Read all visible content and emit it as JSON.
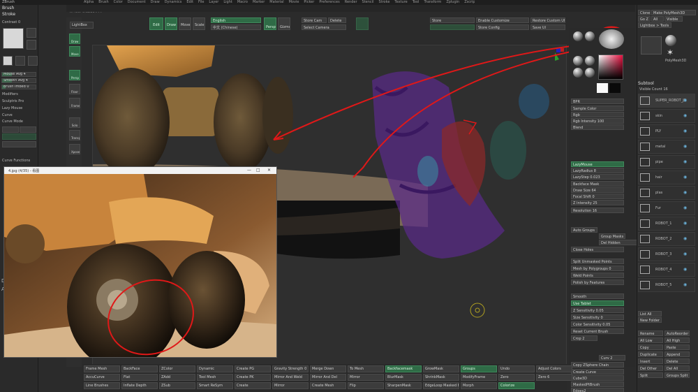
{
  "topbar": {
    "left_title": "ZBrush",
    "menus": [
      "Alpha",
      "Brush",
      "Color",
      "Document",
      "Draw",
      "Dynamics",
      "Edit",
      "File",
      "Layer",
      "Light",
      "Macro",
      "Marker",
      "Material",
      "Movie",
      "Picker",
      "Preferences",
      "Render",
      "Stencil",
      "Stroke",
      "Texture",
      "Tool",
      "Transform",
      "Zplugin",
      "Zscript",
      "Help"
    ],
    "coords": "X:466.-0.3213.777"
  },
  "left_panel": {
    "tabs": [
      "Brush",
      "Stroke"
    ],
    "header_value": "Contrast 0",
    "items": [
      "Mouse Avg 4",
      "Smooth Avg 4",
      "Brush Imbed 0",
      "Modifiers",
      "Sculptris Pro",
      "Lazy Mouse",
      "Curve",
      "Curve Mode",
      "Curve Functions"
    ],
    "brush_labels": [
      "Standard",
      "Move",
      "DragDot",
      "Spray"
    ],
    "brush_labels2": [
      "FreeHand",
      "Dots",
      "DragRect"
    ],
    "side_letters": [
      "D",
      "A"
    ]
  },
  "toolbar": {
    "lightbox": "LightBox",
    "edit": "Edit",
    "draw": "Draw",
    "move": "Move",
    "scale": "Scale",
    "rotate": "Rotate",
    "english": "English",
    "persp": "Persp",
    "gizmo": "Gizmo",
    "store_cam": "Store Cam",
    "delete": "Delete",
    "select_camera": "Select Camera",
    "store": "Store",
    "enable_customize": "Enable Customize",
    "restore_custom_ui": "Restore Custom UI",
    "store_config": "Store Config",
    "save_ui": "Save UI",
    "flag_cn": "中文 (Chinese)"
  },
  "left_icons": {
    "items": [
      "Draw",
      "Move",
      "Persp",
      "Floor",
      "Frame",
      "Solo",
      "Transp",
      "Xpose"
    ]
  },
  "image_window": {
    "title": "4.jpg (4/35) - 看图",
    "controls": [
      "—",
      "□",
      "✕"
    ]
  },
  "right_inner_panel": {
    "values": [
      "BPR",
      "Sample Color",
      "Rgb",
      "Rgb Intensity 100",
      "Blend",
      "LazyMouse",
      "LazyRadius 8",
      "LazyStep 0.023",
      "Backface Mask",
      "Draw Size 64",
      "Focal Shift 0",
      "Z Intensity 25",
      "Resolution 16",
      "Auto Groups",
      "Group Masks",
      "Del Hidden",
      "Close Holes",
      "Split Unmasked Points",
      "Mesh by Polygroups 0",
      "Weld Points",
      "Polish by Features",
      "Smooth",
      "Use Tablet",
      "Z Sensitivity 0.05",
      "Size Sensitivity 0",
      "Color Sensitivity 0.05",
      "Reset Current Brush",
      "Crop 2",
      "Curv 2",
      "Copy ZSphere Chain",
      "Create Curve",
      "Cube3D",
      "MaskedPtBrush",
      "Edges2",
      "Mrgb",
      "Zadd"
    ],
    "sliders": [
      0.4,
      0.6,
      0.3,
      0.7,
      0.5,
      0.4
    ]
  },
  "right_panel": {
    "header": [
      "Clone",
      "Make PolyMesh3D",
      "Go Z",
      "All",
      "Visible",
      "Lightbox > Tools",
      "Intersect"
    ],
    "tool_name": "PolyMesh3D",
    "subtool_title": "Subtool",
    "visible_count": "Visible Count 16",
    "subtools": [
      "SUPER_ROBOT_JS",
      "skin",
      "PLY",
      "metal",
      "pipe",
      "hair",
      "plas",
      "Fur",
      "ROBOT_1",
      "ROBOT_2",
      "ROBOT_3",
      "ROBOT_4",
      "ROBOT_5"
    ],
    "list_all": "List All",
    "new_folder": "New Folder",
    "actions": [
      "Rename",
      "AutoReorder",
      "All Low",
      "All High",
      "Copy",
      "Paste",
      "Duplicate",
      "Append",
      "Insert",
      "Delete",
      "Del Other",
      "Del All",
      "Split",
      "Groups Split"
    ]
  },
  "bottom": {
    "buttons": [
      "Frame Mesh",
      "AccuCurve",
      "Line Brushes",
      "BackFace",
      "Flat",
      "Inflate Depth",
      "ZColor",
      "ZAdd",
      "ZSub",
      "Dynamic",
      "Tool Mesh",
      "Smart ReSym",
      "Create PG",
      "Create PK",
      "Create",
      "Gravity Strength 0",
      "Mirror And Weld",
      "Mirror",
      "Merge Down",
      "Mirror And Del",
      "Create Mesh",
      "To Mesh",
      "Mirror",
      "Flip",
      "Backfacemask",
      "BlurMask",
      "SharpenMask",
      "GrowMask",
      "ShrinkMask",
      "EdgeLoop Masked Border",
      "Groups",
      "ModifyFrame",
      "Morph",
      "Undo",
      "Zero",
      "Colorize",
      "Adjust Colors",
      "Zero 6"
    ]
  },
  "colors": {
    "accent_green": "#3f8a5c",
    "arrow_red": "#e01818",
    "panel_bg": "#2b2b2b",
    "viewport_bg": "#2e2e2e"
  }
}
